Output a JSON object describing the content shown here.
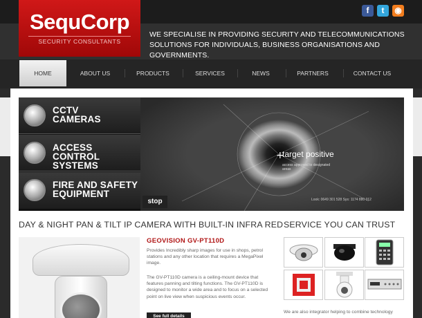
{
  "brand": {
    "name": "SequCorp",
    "subtitle": "SECURITY CONSULTANTS"
  },
  "tagline": "WE SPECIALISE IN PROVIDING SECURITY AND TELECOMMUNICATIONS SOLUTIONS FOR INDIVIDUALS, BUSINESS ORGANISATIONS AND GOVERNMENTS.",
  "social": [
    {
      "icon": "facebook-icon",
      "glyph": "f",
      "color": "#3b5998"
    },
    {
      "icon": "twitter-icon",
      "glyph": "t",
      "color": "#33a6dc"
    },
    {
      "icon": "rss-icon",
      "glyph": "◉",
      "color": "#f27d1e"
    }
  ],
  "nav": {
    "active": "HOME",
    "items": [
      "HOME",
      "ABOUT US",
      "PRODUCTS",
      "SERVICES",
      "NEWS",
      "PARTNERS",
      "CONTACT US"
    ]
  },
  "slider": {
    "tabs": [
      {
        "line1": "CCTV",
        "line2": "CAMERAS"
      },
      {
        "line1": "ACCESS CONTROL",
        "line2": "SYSTEMS"
      },
      {
        "line1": "FIRE AND SAFETY",
        "line2": "EQUIPMENT"
      }
    ],
    "overlay_title": "target positive",
    "overlay_sub": "access approved to designated areas",
    "overlay_lines": "Look: 0649 301 528 Sys: 1174 880 012",
    "stop_label": "stop"
  },
  "featured": {
    "heading": "DAY & NIGHT PAN & TILT IP CAMERA WITH BUILT-IN INFRA RED",
    "product_title": "GEOVISION GV-PT110D",
    "para1": "Provides Incredibly sharp images for use in shops, petrol stations and any other location that requires a MegaPixel image.",
    "para2": "The GV-PT110D camera is a ceiling-mount device that features panning and tilting functions. The GV-PT110D is designed to monitor a wide area and to focus on a selected point on live view when suspicious events occur.",
    "button": "See full details"
  },
  "services": {
    "heading": "SERVICE YOU CAN TRUST",
    "thumbs": [
      "dome-camera",
      "black-dome-camera",
      "keypad",
      "fire-alarm",
      "ptz-camera",
      "dvr-recorder"
    ],
    "text": "We are also integrator helping to combine technology"
  }
}
